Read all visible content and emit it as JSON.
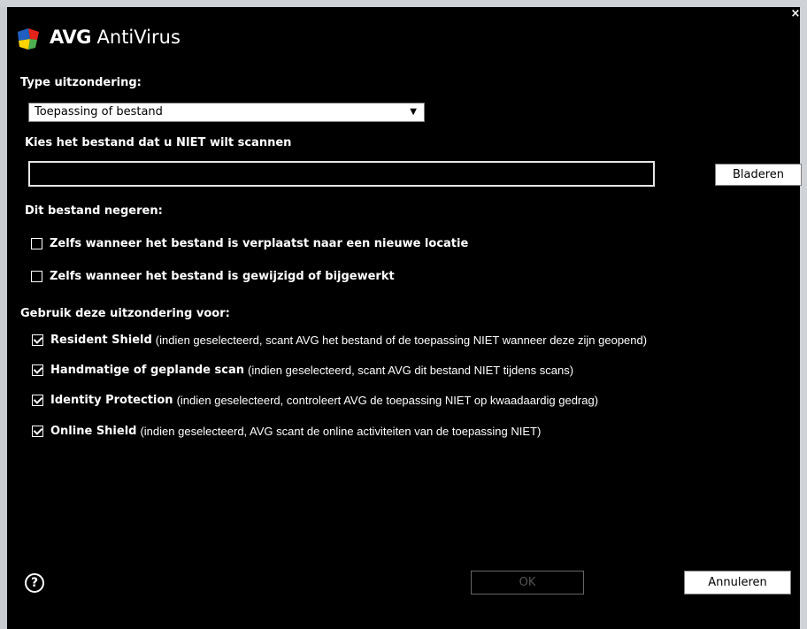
{
  "app": {
    "brand": "AVG",
    "product": "AntiVirus",
    "close_glyph": "×"
  },
  "exception_type": {
    "label": "Type uitzondering:",
    "selected": "Toepassing of bestand",
    "arrow": "▼"
  },
  "file": {
    "label": "Kies het bestand dat u NIET wilt scannen",
    "value": "",
    "browse_label": "Bladeren"
  },
  "ignore": {
    "label": "Dit bestand negeren:",
    "options": [
      {
        "label": "Zelfs wanneer het bestand is verplaatst naar een nieuwe locatie",
        "checked": false
      },
      {
        "label": "Zelfs wanneer het bestand is gewijzigd of bijgewerkt",
        "checked": false
      }
    ]
  },
  "use_for": {
    "label": "Gebruik deze uitzondering voor:",
    "options": [
      {
        "name": "Resident Shield",
        "desc": "(indien geselecteerd, scant AVG het bestand of de toepassing NIET wanneer deze zijn geopend)",
        "checked": true
      },
      {
        "name": "Handmatige of geplande scan",
        "desc": "(indien geselecteerd, scant AVG dit bestand NIET tijdens scans)",
        "checked": true
      },
      {
        "name": "Identity Protection",
        "desc": "(indien geselecteerd, controleert AVG de toepassing NIET op kwaadaardig gedrag)",
        "checked": true
      },
      {
        "name": "Online Shield",
        "desc": "(indien geselecteerd, AVG scant de online activiteiten van de toepassing NIET)",
        "checked": true
      }
    ]
  },
  "footer": {
    "help_glyph": "?",
    "ok_label": "OK",
    "cancel_label": "Annuleren"
  },
  "colors": {
    "background": "#000000",
    "text": "#ffffff",
    "logo_blue": "#1f5fbf",
    "logo_red": "#e2231a",
    "logo_yellow": "#ffd400",
    "logo_green": "#4caf50"
  }
}
